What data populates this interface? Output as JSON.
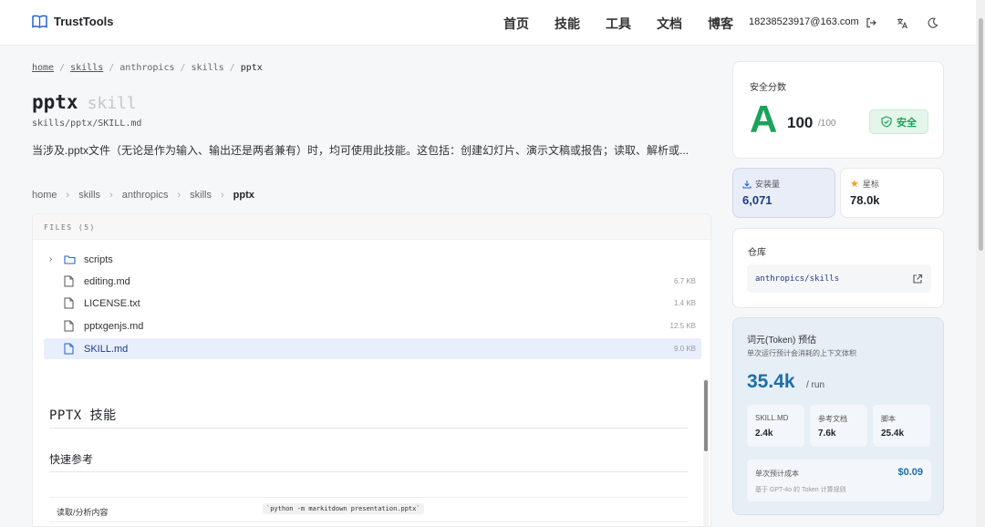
{
  "header": {
    "brand": "TrustTools",
    "nav": [
      "首页",
      "技能",
      "工具",
      "文档",
      "博客"
    ],
    "email": "18238523917@163.com",
    "icons": [
      "logout-icon",
      "translate-icon",
      "moon-icon"
    ]
  },
  "breadcrumb_top": {
    "items": [
      "home",
      "skills",
      "anthropics",
      "skills",
      "pptx"
    ],
    "separator": "/"
  },
  "skill": {
    "name": "pptx",
    "tag": "skill",
    "path": "skills/pptx/SKILL.md",
    "description": "当涉及.pptx文件（无论是作为输入、输出还是两者兼有）时，均可使用此技能。这包括：创建幻灯片、演示文稿或报告；读取、解析或..."
  },
  "breadcrumb_files": {
    "items": [
      "home",
      "skills",
      "anthropics",
      "skills",
      "pptx"
    ]
  },
  "files": {
    "header": "FILES (5)",
    "items": [
      {
        "name": "scripts",
        "type": "folder",
        "size": ""
      },
      {
        "name": "editing.md",
        "type": "file",
        "size": "6.7 KB"
      },
      {
        "name": "LICENSE.txt",
        "type": "file",
        "size": "1.4 KB"
      },
      {
        "name": "pptxgenjs.md",
        "type": "file",
        "size": "12.5 KB"
      },
      {
        "name": "SKILL.md",
        "type": "file",
        "size": "9.0 KB",
        "selected": true
      }
    ]
  },
  "doc": {
    "h1": "PPTX 技能",
    "h2": "快速参考",
    "row_key": "读取/分析内容",
    "row_value": "`python -m markitdown presentation.pptx`"
  },
  "score": {
    "label": "安全分数",
    "grade": "A",
    "value": "100",
    "max": "/100",
    "badge": "安全"
  },
  "stats": {
    "installs_label": "安装量",
    "installs_value": "6,071",
    "stars_label": "星标",
    "stars_value": "78.0k"
  },
  "repo": {
    "title": "仓库",
    "link": "anthropics/skills"
  },
  "tokens": {
    "title": "词元(Token) 预估",
    "subtitle": "单次运行预计会消耗的上下文体积",
    "total": "35.4k",
    "unit": "/ run",
    "breakdown": [
      {
        "label": "SKILL.MD",
        "value": "2.4k"
      },
      {
        "label": "参考文档",
        "value": "7.6k"
      },
      {
        "label": "脚本",
        "value": "25.4k"
      }
    ],
    "cost_label": "单次预计成本",
    "cost_value": "$0.09",
    "cost_note": "基于 GPT-4o 的 Token 计算规则"
  },
  "colors": {
    "accent_green": "#1aa35a",
    "accent_blue": "#1a6fa8",
    "link_blue": "#1f3b8a"
  }
}
